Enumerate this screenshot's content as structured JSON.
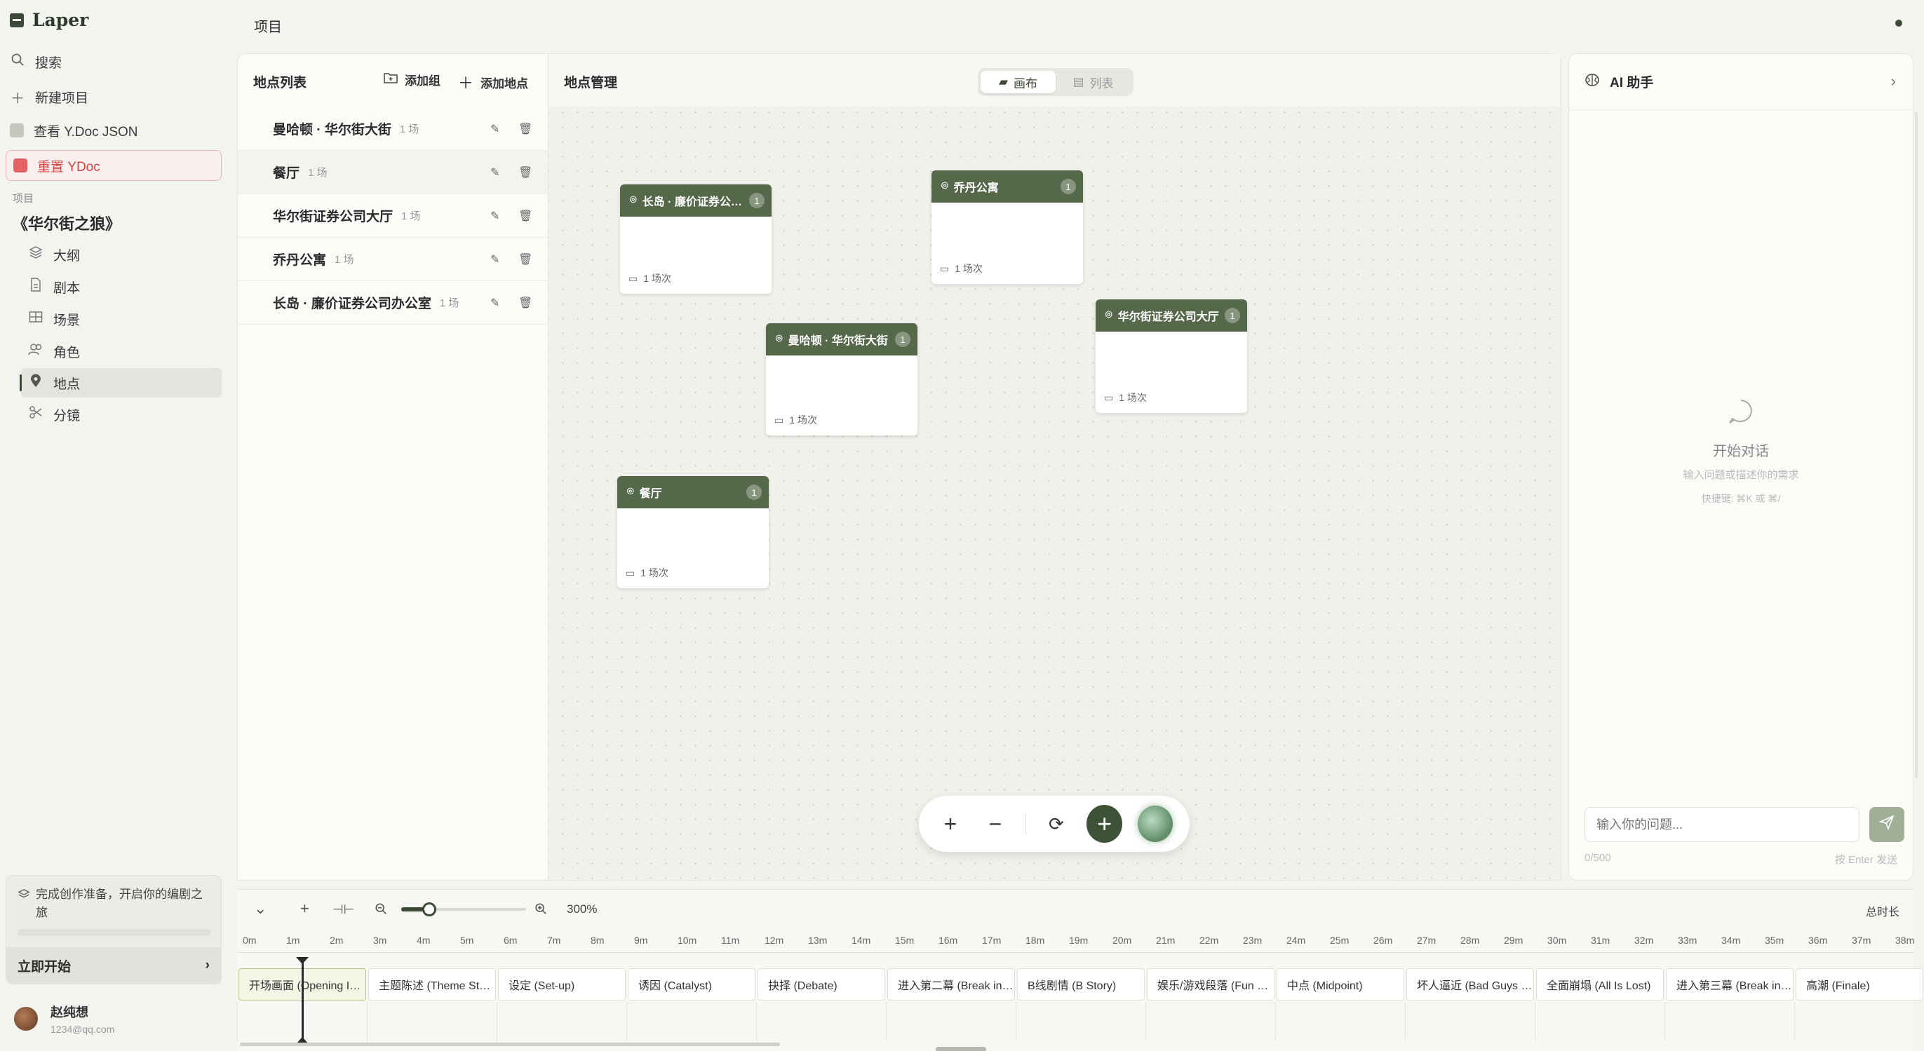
{
  "app": {
    "name": "Laper",
    "top_title": "项目"
  },
  "sidebar": {
    "search": "搜索",
    "new_project": "新建项目",
    "view_ydoc": "查看 Y.Doc JSON",
    "reset_ydoc": "重置 YDoc",
    "section_label": "项目",
    "project_title": "《华尔街之狼》",
    "nav": [
      {
        "label": "大纲",
        "icon": "layers-icon"
      },
      {
        "label": "剧本",
        "icon": "document-icon"
      },
      {
        "label": "场景",
        "icon": "film-icon"
      },
      {
        "label": "角色",
        "icon": "users-icon"
      },
      {
        "label": "地点",
        "icon": "location-pin-icon",
        "active": true
      },
      {
        "label": "分镜",
        "icon": "storyboard-icon"
      }
    ],
    "onboarding": {
      "text": "完成创作准备，开启你的编剧之旅",
      "button": "立即开始",
      "progress": 0
    },
    "user": {
      "name": "赵纯想",
      "email": "1234@qq.com"
    }
  },
  "location_list": {
    "title": "地点列表",
    "add_group": "添加组",
    "add_location": "添加地点",
    "items": [
      {
        "name": "曼哈顿 · 华尔街大街",
        "count": "1 场"
      },
      {
        "name": "餐厅",
        "count": "1 场"
      },
      {
        "name": "华尔街证券公司大厅",
        "count": "1 场"
      },
      {
        "name": "乔丹公寓",
        "count": "1 场"
      },
      {
        "name": "长岛 · 廉价证券公司办公室",
        "count": "1 场"
      }
    ]
  },
  "canvas": {
    "title": "地点管理",
    "toggle": {
      "canvas": "画布",
      "list": "列表",
      "selected": "canvas"
    },
    "nodes": [
      {
        "title": "长岛 · 廉价证券公司办公室",
        "badge": "1",
        "scenes": "1 场次"
      },
      {
        "title": "乔丹公寓",
        "badge": "1",
        "scenes": "1 场次"
      },
      {
        "title": "华尔街证券公司大厅",
        "badge": "1",
        "scenes": "1 场次"
      },
      {
        "title": "曼哈顿 · 华尔街大街",
        "badge": "1",
        "scenes": "1 场次"
      },
      {
        "title": "餐厅",
        "badge": "1",
        "scenes": "1 场次"
      }
    ]
  },
  "ai": {
    "title": "AI 助手",
    "empty_title": "开始对话",
    "empty_sub": "输入问题或描述你的需求",
    "shortcut": "快捷键: ⌘K 或 ⌘/",
    "input_placeholder": "输入你的问题...",
    "counter": "0/500",
    "send_hint": "按 Enter 发送"
  },
  "timeline": {
    "zoom": "300%",
    "total_label": "总时长",
    "ticks": [
      "0m",
      "1m",
      "2m",
      "3m",
      "4m",
      "5m",
      "6m",
      "7m",
      "8m",
      "9m",
      "10m",
      "11m",
      "12m",
      "13m",
      "14m",
      "15m",
      "16m",
      "17m",
      "18m",
      "19m",
      "20m",
      "21m",
      "22m",
      "23m",
      "24m",
      "25m",
      "26m",
      "27m",
      "28m",
      "29m",
      "30m",
      "31m",
      "32m",
      "33m",
      "34m",
      "35m",
      "36m",
      "37m",
      "38m"
    ],
    "beats": [
      "开场画面 (Opening Image)",
      "主题陈述 (Theme Stated)",
      "设定 (Set-up)",
      "诱因 (Catalyst)",
      "抉择 (Debate)",
      "进入第二幕 (Break into Two)",
      "B线剧情 (B Story)",
      "娱乐/游戏段落 (Fun and Games)",
      "中点 (Midpoint)",
      "坏人逼近 (Bad Guys Close In)",
      "全面崩塌 (All Is Lost)",
      "进入第三幕 (Break into Three)",
      "高潮 (Finale)"
    ]
  }
}
